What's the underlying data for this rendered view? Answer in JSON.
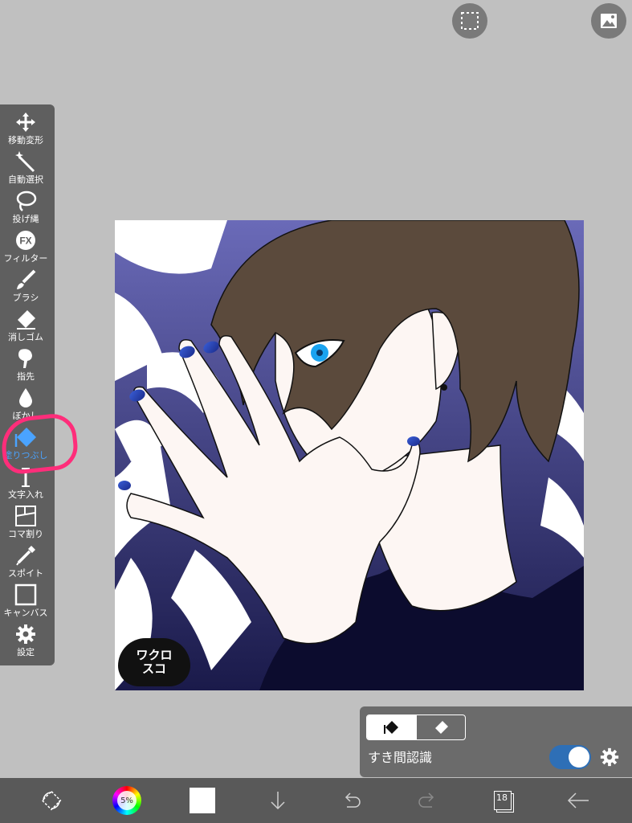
{
  "top": {
    "select_icon": "dashed-selection-icon",
    "gallery_icon": "image-icon"
  },
  "toolbar": {
    "tools": [
      {
        "label": "移動変形",
        "icon": "move-arrows-icon"
      },
      {
        "label": "自動選択",
        "icon": "magic-wand-icon"
      },
      {
        "label": "投げ縄",
        "icon": "lasso-icon"
      },
      {
        "label": "フィルター",
        "icon": "fx-icon"
      },
      {
        "label": "ブラシ",
        "icon": "brush-icon"
      },
      {
        "label": "消しゴム",
        "icon": "eraser-icon"
      },
      {
        "label": "指先",
        "icon": "smudge-icon"
      },
      {
        "label": "ぼかし",
        "icon": "blur-drop-icon"
      },
      {
        "label": "塗りつぶし",
        "icon": "fill-bucket-icon"
      },
      {
        "label": "文字入れ",
        "icon": "text-cursor-icon"
      },
      {
        "label": "コマ割り",
        "icon": "frame-divider-icon"
      },
      {
        "label": "スポイト",
        "icon": "eyedropper-icon"
      },
      {
        "label": "キャンバス",
        "icon": "canvas-icon"
      },
      {
        "label": "設定",
        "icon": "gear-icon"
      }
    ],
    "active_tool": "塗りつぶし",
    "highlight_color": "#ff2d7a"
  },
  "canvas": {
    "signature": "ワクロ\nスコ"
  },
  "fill_panel": {
    "modes": [
      "fill-bucket-icon",
      "eraser-icon"
    ],
    "gap_detection_label": "すき間認識",
    "gap_detection_on": true,
    "settings_icon": "gear-icon"
  },
  "bottombar": {
    "color_percent": "5%",
    "current_color": "#ffffff",
    "layer_count": "18",
    "icons": [
      "transform-icon",
      "color-wheel-icon",
      "color-swatch",
      "download-icon",
      "undo-icon",
      "redo-icon",
      "layers-icon",
      "back-arrow-icon"
    ]
  },
  "colors": {
    "toolbar_bg": "#5f5f5f",
    "app_bg": "#c0c0c0",
    "accent_blue": "#4aa3ff",
    "toggle_blue": "#2e6fb6"
  }
}
